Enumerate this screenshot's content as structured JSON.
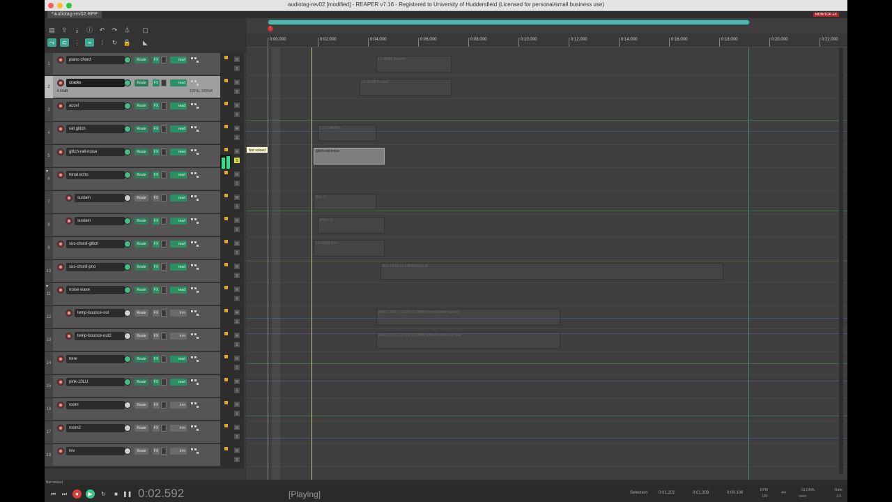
{
  "window": {
    "title": "audiotag-rev02 [modified] - REAPER v7.16 - Registered to University of Huddersfield (Licensed for personal/small business use)",
    "tab": "*audiotag-rev02.RPP",
    "monitor_fx": "MONITOR FX"
  },
  "toolbar": {
    "icons": [
      "new-project-icon",
      "open-project-icon",
      "save-project-icon",
      "project-settings-icon",
      "undo-icon",
      "redo-icon",
      "metronome-icon",
      "render-icon",
      "ripple-icon",
      "item-grouping-icon",
      "snap-icon",
      "grid-icon",
      "envelope-lock-icon",
      "lock-icon",
      "trim-icon"
    ]
  },
  "tracks": [
    {
      "num": "1",
      "name": "piano chord",
      "route": "Route",
      "fx": "FX",
      "auto": "read",
      "indent": 0,
      "vol_color": "green"
    },
    {
      "num": "2",
      "name": "cracks",
      "route": "Route",
      "fx": "FX",
      "auto": "read",
      "indent": 0,
      "vol_color": "green",
      "selected": true,
      "vol": "-4.42dB",
      "pan": "100%L 100%R"
    },
    {
      "num": "3",
      "name": "accel",
      "route": "Route",
      "fx": "FX",
      "auto": "read",
      "indent": 0,
      "vol_color": "green"
    },
    {
      "num": "4",
      "name": "rall glitch",
      "route": "Route",
      "fx": "FX",
      "auto": "read",
      "indent": 0,
      "vol_color": "green"
    },
    {
      "num": "5",
      "name": "glitch-rall-noise",
      "route": "Route",
      "fx": "FX",
      "auto": "read",
      "indent": 0,
      "vol_color": "green"
    },
    {
      "num": "6",
      "name": "tonal echo",
      "route": "Route",
      "fx": "FX",
      "auto": "read",
      "indent": 0,
      "vol_color": "green",
      "folder": true
    },
    {
      "num": "7",
      "name": "sustain",
      "route": "Route",
      "fx": "FX",
      "auto": "read",
      "indent": 1,
      "vol_color": "grey"
    },
    {
      "num": "8",
      "name": "sustain",
      "route": "Route",
      "fx": "FX",
      "auto": "read",
      "indent": 1,
      "vol_color": "green"
    },
    {
      "num": "9",
      "name": "sus-chord-glitch",
      "route": "Route",
      "fx": "FX",
      "auto": "read",
      "indent": 0,
      "vol_color": "green"
    },
    {
      "num": "10",
      "name": "sus-chord-pno",
      "route": "Route",
      "fx": "FX",
      "auto": "read",
      "indent": 0,
      "vol_color": "green"
    },
    {
      "num": "11",
      "name": "noise wave",
      "route": "Route",
      "fx": "FX",
      "auto": "read",
      "indent": 0,
      "vol_color": "green",
      "folder": true
    },
    {
      "num": "12",
      "name": "temp-bounce-out",
      "route": "Route",
      "fx": "FX",
      "auto": "trim",
      "indent": 1,
      "vol_color": "grey"
    },
    {
      "num": "13",
      "name": "temp-bounce-out2",
      "route": "Route",
      "fx": "FX",
      "auto": "trim",
      "indent": 1,
      "vol_color": "grey"
    },
    {
      "num": "14",
      "name": "tone",
      "route": "Route",
      "fx": "FX",
      "auto": "read",
      "indent": 0,
      "vol_color": "green"
    },
    {
      "num": "15",
      "name": "pink-10LU",
      "route": "Route",
      "fx": "FX",
      "auto": "read",
      "indent": 0,
      "vol_color": "green"
    },
    {
      "num": "16",
      "name": "room",
      "route": "Route",
      "fx": "FX",
      "auto": "trim",
      "indent": 0,
      "vol_color": "grey"
    },
    {
      "num": "17",
      "name": "room2",
      "route": "Route",
      "fx": "FX",
      "auto": "trim",
      "indent": 0,
      "vol_color": "grey"
    },
    {
      "num": "18",
      "name": "rev",
      "route": "Route",
      "fx": "FX",
      "auto": "trim",
      "indent": 0,
      "vol_color": "grey"
    }
  ],
  "mixer_strip": {
    "mute": "M",
    "solo": "S"
  },
  "tooltip": "Not soloed",
  "ruler": {
    "marks": [
      "0:00.000",
      "0:02.000",
      "0:04.000",
      "0:06.000",
      "0:08.000",
      "0:10.000",
      "0:12.000",
      "0:14.000",
      "0:16.000",
      "0:18.000",
      "0:20.000",
      "0:22.000"
    ]
  },
  "items": [
    {
      "lane": 0,
      "label": "[-1.40dB] 4-piano",
      "from": "0:04.333",
      "to": "0:07.333"
    },
    {
      "lane": 1,
      "label": "[-0.92dB] 4-crack",
      "from": "0:03.667",
      "to": "0:07.333"
    },
    {
      "lane": 3,
      "label": "[-3.97dB] Rec-",
      "from": "0:02.000",
      "to": "0:04.333"
    },
    {
      "lane": 4,
      "label": "glitch-rall-noise.",
      "from": "0:01.833",
      "to": "0:04.667",
      "selected": true
    },
    {
      "lane": 6,
      "label": "Rec-1)",
      "from": "0:01.833",
      "to": "0:04.333"
    },
    {
      "lane": 7,
      "label": "[Pitch-6]",
      "from": "0:02.000",
      "to": "0:04.667"
    },
    {
      "lane": 8,
      "label": "[-4.09dB] Rec-",
      "from": "0:01.833",
      "to": "0:04.667"
    },
    {
      "lane": 9,
      "label": "Rec-18-01-16-10h40m53s.aif",
      "from": "0:04.500",
      "to": "0:18.167"
    },
    {
      "lane": 11,
      "label": "[Rate 1.000 (+10.19) v1.00dB] temp-bounce-out.wav",
      "from": "0:04.333",
      "to": "0:11.667"
    },
    {
      "lane": 12,
      "label": "[Rate 1.000 (+10.19) v1.00dB] temp-bounce-out2.wav",
      "from": "0:04.333",
      "to": "0:11.667"
    }
  ],
  "status": "Not soloed",
  "transport": {
    "time": "0:02.592",
    "state": "[Playing]",
    "selection_label": "Selection:",
    "sel_start": "0:01.202",
    "sel_end": "0:01.309",
    "sel_len": "0:00.106",
    "bpm_label": "BPM",
    "bpm": "120",
    "sig": "4/4",
    "global_label": "GLOBAL",
    "global_val": "none",
    "rate_label": "Rate:",
    "rate_val": "1.0"
  }
}
